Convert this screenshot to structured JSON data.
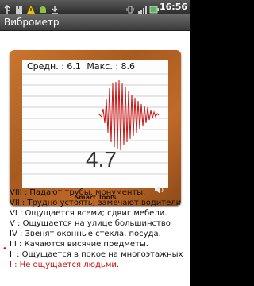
{
  "status_bar": {
    "time": "16:56"
  },
  "title_bar": {
    "title": "Виброметр"
  },
  "meter": {
    "avg_label": "Средн. : 6.1",
    "max_label": "Макс. : 8.6",
    "reading": "4.7",
    "brand": "Smart Tools"
  },
  "scale": [
    "VIII : Падают трубы, монументы.",
    "VII : Трудно устоять; замечают водители",
    "VI : Ощущается всеми; сдвиг мебели.",
    "V : Ощущается на улице большинство",
    "IV : Звенят оконные стекла, посуда.",
    "III : Качаются висячие предметы.",
    "II : Ощущается в покое на многоэтажных",
    "I : Не ощущается людьми."
  ],
  "current_level_marker": "•",
  "colors": {
    "accent": "#c81414",
    "frame": "#b3641f"
  }
}
